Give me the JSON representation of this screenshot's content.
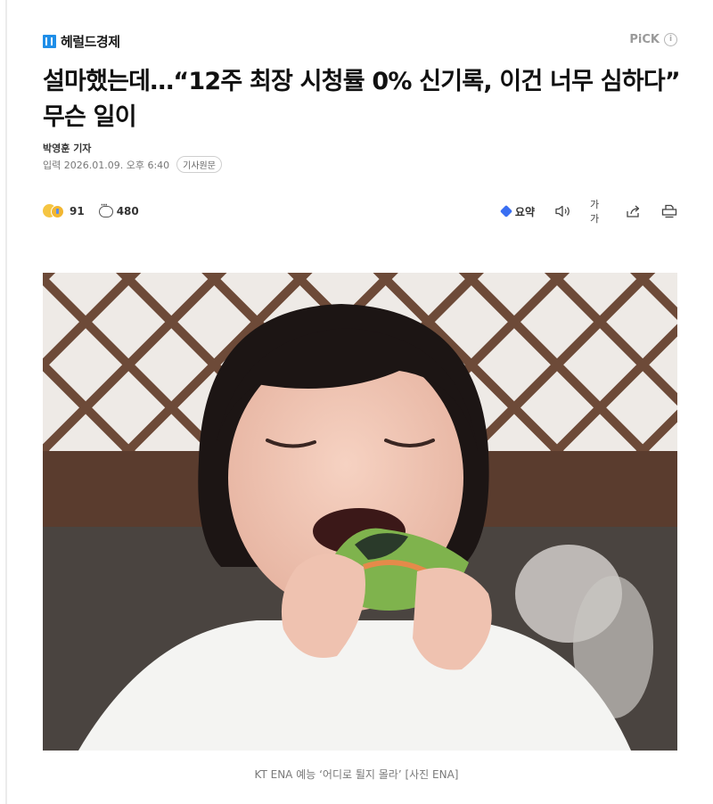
{
  "header": {
    "logo_text": "헤럴드경제",
    "pick_label": "PiCK",
    "pick_info_icon": "info-icon"
  },
  "article": {
    "headline": "설마했는데…“12주 최장 시청률 0% 신기록, 이건 너무 심하다” 무슨 일이",
    "reporter": "박영훈 기자",
    "date_label": "입력 2026.01.09. 오후 6:40",
    "original_button": "기사원문"
  },
  "actions": {
    "reaction_count": "91",
    "comment_count": "480",
    "summary_label": "요약",
    "font_size_label": "가가",
    "icons": [
      "reaction-emoji-icon",
      "comment-icon",
      "summary-spark-icon",
      "speaker-icon",
      "share-icon",
      "print-icon"
    ]
  },
  "photo": {
    "caption": "KT ENA 예능 ‘어디로 튈지 몰라’ [사진 ENA]"
  },
  "colors": {
    "accent": "#1f8ee8",
    "summary_icon": "#3a6ff2",
    "meta_text": "#777777"
  }
}
